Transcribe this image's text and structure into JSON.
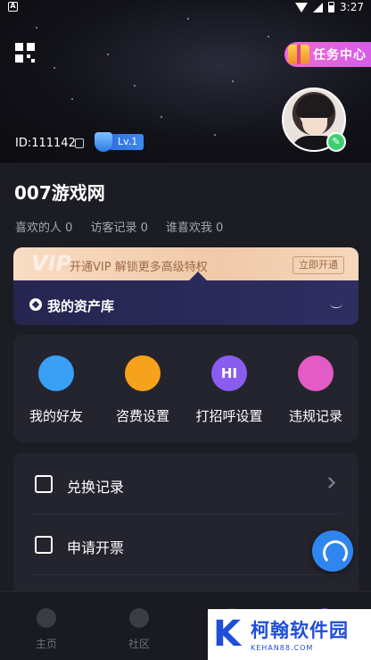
{
  "status_bar": {
    "time": "3:27",
    "app_indicator": "A",
    "icons": [
      "wifi-icon",
      "signal-icon",
      "battery-icon"
    ]
  },
  "header": {
    "task_center_label": "任务中心",
    "user_id": "ID:111142",
    "level": "Lv.1"
  },
  "profile": {
    "site_name": "007游戏网",
    "stats": [
      {
        "label": "喜欢的人",
        "value": "0"
      },
      {
        "label": "访客记录",
        "value": "0"
      },
      {
        "label": "谁喜欢我",
        "value": "0"
      }
    ]
  },
  "vip": {
    "watermark": "VIP",
    "promo_text": "开通VIP 解锁更多高级特权",
    "open_button": "立即开通",
    "assets_label": "我的资产库"
  },
  "shortcuts": [
    {
      "label": "我的好友",
      "icon": "friends-icon",
      "glyph": "",
      "color": "#3aa0f5"
    },
    {
      "label": "咨费设置",
      "icon": "fee-icon",
      "glyph": "",
      "color": "#f7a21c"
    },
    {
      "label": "打招呼设置",
      "icon": "greeting-icon",
      "glyph": "HI",
      "color": "#8a5cf0"
    },
    {
      "label": "违规记录",
      "icon": "violation-icon",
      "glyph": "",
      "color": "#e35bc4"
    }
  ],
  "menu": [
    {
      "label": "兑换记录",
      "icon": "exchange-icon"
    },
    {
      "label": "申请开票",
      "icon": "invoice-icon"
    }
  ],
  "tabbar": [
    {
      "label": "主页",
      "icon": "home-icon"
    },
    {
      "label": "社区",
      "icon": "community-icon"
    },
    {
      "label": "",
      "icon": "message-icon"
    },
    {
      "label": "",
      "icon": "profile-icon"
    }
  ],
  "watermark": {
    "mark": "K",
    "title": "柯翰软件园",
    "url": "KEHAN88.COM"
  }
}
